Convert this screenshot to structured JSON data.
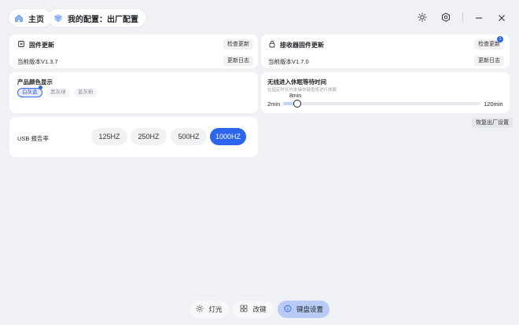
{
  "header": {
    "home_label": "主页",
    "config_label": "我的配置：出厂配置"
  },
  "firmware": {
    "title": "固件更新",
    "check_label": "检查更新",
    "version_text": "当前版本V1.3.7",
    "changelog_label": "更新日志"
  },
  "receiver": {
    "title": "接收器固件更新",
    "check_label": "检查更新",
    "badge_count": "1",
    "version_text": "当前版本V1.7.0",
    "changelog_label": "更新日志"
  },
  "color": {
    "title": "产品颜色显示",
    "options": [
      "白灰蓝",
      "黑灰绿",
      "蓝灰粉"
    ],
    "selected": "白灰蓝"
  },
  "sleep": {
    "title": "无线进入休眠等待时间",
    "subtitle": "在指定时长内未操作键盘将进行休眠",
    "min_label": "2min",
    "max_label": "120min",
    "current_label": "8min",
    "min": 2,
    "max": 120,
    "value": 8
  },
  "reset_label": "恢复出厂设置",
  "usb": {
    "label": "USB 报告率",
    "rates": [
      "125HZ",
      "250HZ",
      "500HZ",
      "1000HZ"
    ],
    "selected": "1000HZ"
  },
  "bottom_nav": {
    "light": "灯光",
    "remap": "改键",
    "keyboard": "键盘设置"
  },
  "colors": {
    "accent": "#2c66ef",
    "background": "#eff1f5",
    "card": "#ffffff"
  }
}
